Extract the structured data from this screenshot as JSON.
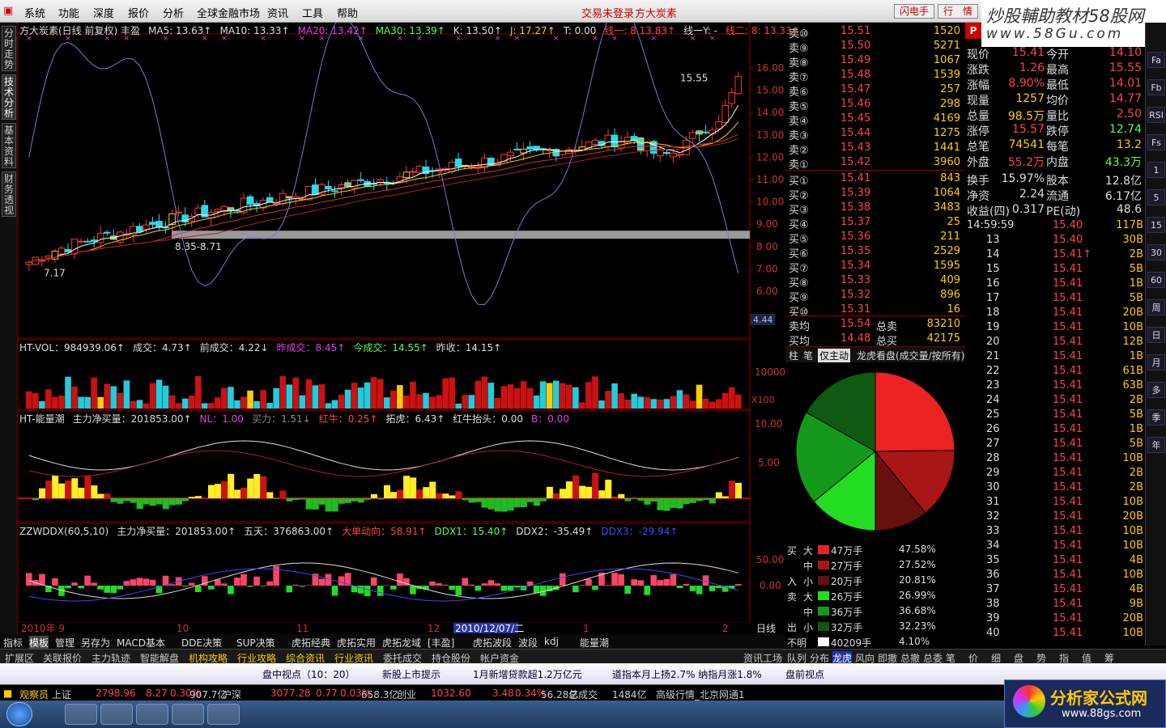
{
  "menu": [
    "系统",
    "功能",
    "深度",
    "报价",
    "分析",
    "全球金融市场",
    "资讯",
    "工具",
    "帮助"
  ],
  "login_notice": "交易未登录",
  "stock_name": "方大炭素",
  "btn_flash": "闪电手",
  "btn_quote": "行　情",
  "site_logo": {
    "line1": "炒股輔助教材58股网",
    "line2": "www.58Gu.com"
  },
  "side_tabs": [
    "分时走势",
    "技术分析",
    "基本资料",
    "财务透视"
  ],
  "main_header": [
    "方大炭素(日线 前复权) 丰盈",
    "MA5: 13.63↑",
    "MA10: 13.33↑",
    "MA20: 13.42↑",
    "MA30: 13.39↑",
    "K: 13.50↑",
    "J: 17.27↑",
    "T: 0.00",
    "线一: 8.13.83↑",
    "线一Y: -",
    "线二: 8: 13.33↑"
  ],
  "price_axis": [
    "16.00",
    "15.00",
    "14.00",
    "13.00",
    "12.00",
    "11.00",
    "10.00",
    "9.00",
    "8.00",
    "7.00",
    "6.00"
  ],
  "price_labels": {
    "high": "15.55",
    "low": "7.17",
    "band": "8.35-8.71",
    "cursor": "4.44"
  },
  "vol_header": [
    "HT-VOL：984939.06↑",
    "成交：4.73↑",
    "前成交：4.22↓",
    "昨成交：8.45↑",
    "今成交：14.55↑",
    "昨收：14.15↑"
  ],
  "vol_axis": [
    "10000",
    "X100"
  ],
  "energy_header": [
    "HT-能量潮",
    "主力净买量：201853.00↑",
    "NL：1.00",
    "买力：1.51↓",
    "红牛：0.25↑",
    "拓虎：6.43↑",
    "红牛抬头：0.00",
    "B：0.00"
  ],
  "energy_axis": [
    "10.00",
    "5.00"
  ],
  "ddx_header": [
    "ZZWDDX(60,5,10)",
    "主力净买量：201853.00↑",
    "五天：376863.00↑",
    "大单动向：58.91↑",
    "DDX1：15.40↑",
    "DDX2：-35.49↑",
    "DDX3：-29.94↑"
  ],
  "ddx_axis": [
    "50.00",
    "0.00"
  ],
  "date_axis": [
    "2010年 9",
    "10",
    "11",
    "12",
    "2010/12/07/二",
    "1",
    "2"
  ],
  "period": "日线",
  "sell": [
    {
      "lab": "卖⑩",
      "p": "15.51",
      "v": "1520"
    },
    {
      "lab": "卖⑨",
      "p": "15.50",
      "v": "5271"
    },
    {
      "lab": "卖⑧",
      "p": "15.49",
      "v": "1067"
    },
    {
      "lab": "卖⑦",
      "p": "15.48",
      "v": "1539"
    },
    {
      "lab": "卖⑥",
      "p": "15.47",
      "v": "257"
    },
    {
      "lab": "卖⑤",
      "p": "15.46",
      "v": "298"
    },
    {
      "lab": "卖④",
      "p": "15.45",
      "v": "4169"
    },
    {
      "lab": "卖③",
      "p": "15.44",
      "v": "1275"
    },
    {
      "lab": "卖②",
      "p": "15.43",
      "v": "1441"
    },
    {
      "lab": "卖①",
      "p": "15.42",
      "v": "3960"
    }
  ],
  "buy": [
    {
      "lab": "买①",
      "p": "15.41",
      "v": "843"
    },
    {
      "lab": "买②",
      "p": "15.39",
      "v": "1064"
    },
    {
      "lab": "买③",
      "p": "15.38",
      "v": "3483"
    },
    {
      "lab": "买④",
      "p": "15.37",
      "v": "25"
    },
    {
      "lab": "买⑤",
      "p": "15.36",
      "v": "211"
    },
    {
      "lab": "买⑥",
      "p": "15.35",
      "v": "2529"
    },
    {
      "lab": "买⑦",
      "p": "15.34",
      "v": "1595"
    },
    {
      "lab": "买⑧",
      "p": "15.33",
      "v": "409"
    },
    {
      "lab": "买⑨",
      "p": "15.32",
      "v": "896"
    },
    {
      "lab": "买⑩",
      "p": "15.31",
      "v": "16"
    }
  ],
  "avg": [
    {
      "lab": "卖均",
      "p": "15.54",
      "k": "总卖",
      "v": "83210"
    },
    {
      "lab": "买均",
      "p": "14.48",
      "k": "总买",
      "v": "42175"
    }
  ],
  "info": [
    [
      "现价",
      "15.41",
      "今开",
      "14.10"
    ],
    [
      "涨跌",
      "1.26",
      "最高",
      "15.55"
    ],
    [
      "涨幅",
      "8.90%",
      "最低",
      "14.01"
    ],
    [
      "现量",
      "1257",
      "均价",
      "14.77"
    ],
    [
      "总量",
      "98.5万",
      "量比",
      "2.50"
    ],
    [
      "涨停",
      "15.57",
      "跌停",
      "12.74"
    ],
    [
      "总笔",
      "74541",
      "每笔",
      "13.2"
    ],
    [
      "外盘",
      "55.2万",
      "内盘",
      "43.3万"
    ],
    [
      "换手",
      "15.97%",
      "股本",
      "12.8亿"
    ],
    [
      "净资",
      "2.24",
      "流通",
      "6.17亿"
    ],
    [
      "收益(四)",
      "0.317",
      "PE(动)",
      "48.6"
    ]
  ],
  "ticks": [
    [
      "14:59:59",
      "15.40",
      "117B"
    ],
    [
      "13",
      "15.40",
      "30B"
    ],
    [
      "14",
      "15.41↑",
      "2B"
    ],
    [
      "15",
      "15.41",
      "5B"
    ],
    [
      "16",
      "15.41",
      "1B"
    ],
    [
      "17",
      "15.41",
      "5B"
    ],
    [
      "18",
      "15.41",
      "20B"
    ],
    [
      "19",
      "15.41",
      "10B"
    ],
    [
      "20",
      "15.41",
      "12B"
    ],
    [
      "21",
      "15.41",
      "1B"
    ],
    [
      "22",
      "15.41",
      "61B"
    ],
    [
      "23",
      "15.41",
      "63B"
    ],
    [
      "24",
      "15.41",
      "2B"
    ],
    [
      "25",
      "15.41",
      "5B"
    ],
    [
      "26",
      "15.41",
      "1B"
    ],
    [
      "27",
      "15.41",
      "5B"
    ],
    [
      "28",
      "15.41",
      "10B"
    ],
    [
      "29",
      "15.41",
      "2B"
    ],
    [
      "30",
      "15.41",
      "2B"
    ],
    [
      "31",
      "15.41",
      "10B"
    ],
    [
      "32",
      "15.41",
      "20B"
    ],
    [
      "33",
      "15.41",
      "10B"
    ],
    [
      "34",
      "15.41",
      "10B"
    ],
    [
      "35",
      "15.41",
      "4B"
    ],
    [
      "36",
      "15.41",
      "10B"
    ],
    [
      "37",
      "15.41",
      "4B"
    ],
    [
      "38",
      "15.41",
      "9B"
    ],
    [
      "39",
      "15.41",
      "20B"
    ],
    [
      "40",
      "15.41",
      "10B"
    ]
  ],
  "right_tools": [
    "Fa",
    "Fb",
    "RSI",
    "Fs",
    "1",
    "5",
    "15",
    "30",
    "60",
    "周",
    "日",
    "月",
    "多",
    "季",
    "年"
  ],
  "pie_tabs": [
    "柱",
    "笔",
    "仅主动",
    "龙虎看盘(成交量/按所有)"
  ],
  "pie": {
    "slices": [
      {
        "name": "大买",
        "pct": 47.58,
        "color": "#ee2222"
      },
      {
        "name": "中买",
        "pct": 27.52,
        "color": "#aa1515"
      },
      {
        "name": "小买",
        "pct": 20.81,
        "color": "#661010"
      },
      {
        "name": "大卖",
        "pct": 26.99,
        "color": "#22dd22"
      },
      {
        "name": "中卖",
        "pct": 36.68,
        "color": "#15991a"
      },
      {
        "name": "小卖",
        "pct": 32.23,
        "color": "#0d5a10"
      }
    ]
  },
  "legend": [
    {
      "side": "买",
      "size": "大",
      "amt": "47万手",
      "pct": "47.58%",
      "color": "#ee2222"
    },
    {
      "side": "",
      "size": "中",
      "amt": "27万手",
      "pct": "27.52%",
      "color": "#aa1515"
    },
    {
      "side": "入",
      "size": "小",
      "amt": "20万手",
      "pct": "20.81%",
      "color": "#661010"
    },
    {
      "side": "卖",
      "size": "大",
      "amt": "26万手",
      "pct": "26.99%",
      "color": "#22dd22"
    },
    {
      "side": "",
      "size": "中",
      "amt": "36万手",
      "pct": "36.68%",
      "color": "#15991a"
    },
    {
      "side": "出",
      "size": "小",
      "amt": "32万手",
      "pct": "32.23%",
      "color": "#0d5a10"
    },
    {
      "side": "不明",
      "size": "",
      "amt": "40209手",
      "pct": "4.10%",
      "color": "#ffffff"
    }
  ],
  "bottom_tabs1": [
    "指标",
    "模板",
    "管理",
    "另存为",
    "MACD基本",
    "DDE决策",
    "SUP决策",
    "虎拓经典",
    "虎拓实用",
    "虎拓龙域",
    "[丰盈]",
    "虎拓波段",
    "波段",
    "kdj",
    "能量潮"
  ],
  "bottom_tabs2": [
    "扩展区",
    "关联报价",
    "主力轨迹",
    "智能解盘",
    "机构攻略",
    "行业攻略",
    "综合资讯",
    "行业资讯",
    "委托成交",
    "持仓股份",
    "帐户资金"
  ],
  "bottom_tabs2_right": [
    "资讯工场",
    "队列",
    "分布",
    "龙虎",
    "风向",
    "即撤",
    "总撤",
    "总委",
    "笔",
    "价",
    "细",
    "盘",
    "势",
    "指",
    "值",
    "筹"
  ],
  "news": [
    "盘中视点（10：20）",
    "新股上市提示",
    "1月新增贷款超1.2万亿元",
    "道指本月上扬2.7% 纳指月涨1.8%",
    "盘前视点"
  ],
  "status": [
    {
      "t": "观察员",
      "c": "#ffcc00"
    },
    {
      "t": "上证",
      "c": "#ccc"
    },
    {
      "t": "2798.96",
      "c": "#ff4444"
    },
    {
      "t": "8.27",
      "c": "#ff4444"
    },
    {
      "t": "0.30%",
      "c": "#ff4444"
    },
    {
      "t": "907.7亿",
      "c": "#ccc"
    },
    {
      "t": "沪深",
      "c": "#ccc"
    },
    {
      "t": "3077.28",
      "c": "#ff4444"
    },
    {
      "t": "0.77",
      "c": "#ff4444"
    },
    {
      "t": "0.03%",
      "c": "#ff4444"
    },
    {
      "t": "658.3亿",
      "c": "#ccc"
    },
    {
      "t": "创业",
      "c": "#ccc"
    },
    {
      "t": "1032.60",
      "c": "#ff4444"
    },
    {
      "t": "3.48",
      "c": "#ff4444"
    },
    {
      "t": "0.34%",
      "c": "#ff4444"
    },
    {
      "t": "56.28亿",
      "c": "#ccc"
    },
    {
      "t": "总成交",
      "c": "#ccc"
    },
    {
      "t": "1484亿",
      "c": "#ccc"
    },
    {
      "t": "高级行情_北京网通1",
      "c": "#ccc"
    }
  ],
  "brand_logo": {
    "line1": "分析家公式网",
    "line2": "www.88gs.com"
  }
}
